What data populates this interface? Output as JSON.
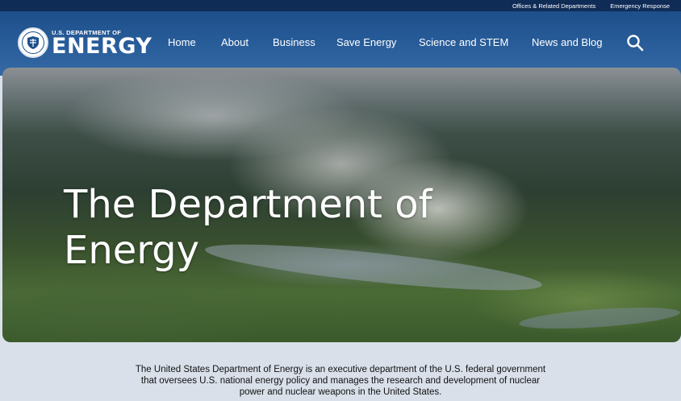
{
  "utility": {
    "links": [
      "Offices & Related Departments",
      "Emergency Response"
    ]
  },
  "logo": {
    "small_text": "U.S. DEPARTMENT OF",
    "big_text": "ENERGY"
  },
  "nav": {
    "items": [
      "Home",
      "About",
      "Business",
      "Save Energy",
      "Science and STEM",
      "News and Blog"
    ]
  },
  "search": {
    "icon": "search-icon"
  },
  "hero": {
    "title": "The Department of Energy"
  },
  "intro": {
    "text": "The United States Department of Energy is an executive department of the U.S. federal government that oversees U.S. national energy policy and manages the research and development of nuclear power and nuclear weapons in the United States."
  },
  "colors": {
    "header_blue": "#1d4f8a",
    "utility_navy": "#0f2c57",
    "page_bg": "#d9e0ea"
  }
}
